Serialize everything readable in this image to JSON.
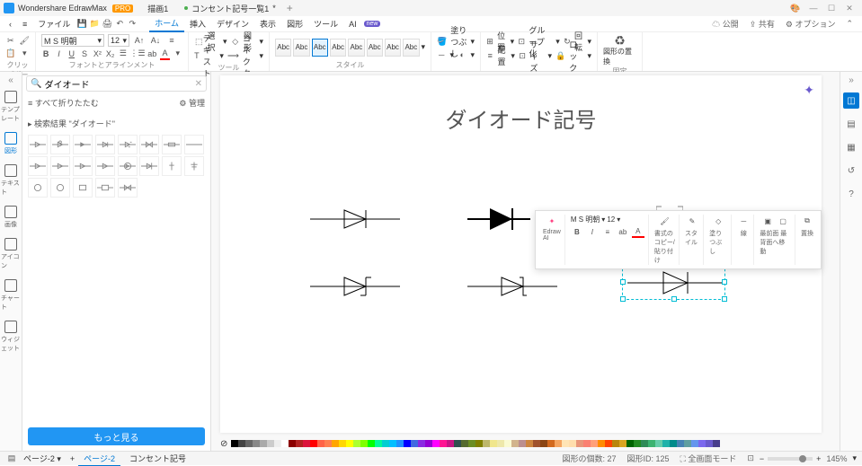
{
  "app": {
    "name": "Wondershare EdrawMax",
    "badge": "PRO"
  },
  "tabs": [
    {
      "label": "描画1"
    },
    {
      "label": "コンセント記号一覧1",
      "modified": true
    }
  ],
  "menu": {
    "back": "‹",
    "hamburger": "≡",
    "file": "ファイル",
    "items": [
      "ホーム",
      "挿入",
      "デザイン",
      "表示",
      "図形",
      "ツール",
      "AI"
    ],
    "active": "ホーム",
    "right": [
      "公開",
      "共有",
      "オプション"
    ]
  },
  "ribbon": {
    "clipboard_label": "クリップボード",
    "font_name": "M S 明朝",
    "font_size": "12",
    "font_label": "フォントとアラインメント",
    "tool_label": "ツール",
    "select": "選択",
    "shape": "図形",
    "text": "テキスト",
    "connector": "コネクタ",
    "style_label": "スタイル",
    "fill": "塗りつぶし",
    "position": "位置",
    "group": "グループ化",
    "rotate": "回転",
    "align": "配置",
    "size": "サイズ",
    "lock": "ロック",
    "replace": "図形の置換",
    "fixed": "固定"
  },
  "sidebar": {
    "items": [
      {
        "label": "テンプレート"
      },
      {
        "label": "図形"
      },
      {
        "label": "テキスト"
      },
      {
        "label": "画像"
      },
      {
        "label": "アイコン"
      },
      {
        "label": "チャート"
      },
      {
        "label": "ウィジェット"
      }
    ],
    "active_index": 1
  },
  "search": {
    "value": "ダイオード"
  },
  "panel": {
    "collapse_all": "すべて折りたたむ",
    "manage": "管理",
    "results_title": "検索結果 \"ダイオード\"",
    "more": "もっと見る"
  },
  "canvas": {
    "title": "ダイオード記号"
  },
  "floating": {
    "ai": "Edraw AI",
    "font": "M S 明朝",
    "size": "12",
    "copy_format": "書式のコピー/貼り付け",
    "style": "スタイル",
    "fill": "塗りつぶし",
    "line": "線",
    "front": "最前面 最背面へ移動",
    "replace": "置換"
  },
  "status": {
    "page1": "ページ-2",
    "page2": "ページ-2",
    "page3": "コンセント記号",
    "shape_count": "図形の個数:  27",
    "shape_id": "図形ID:  125",
    "mode": "全画面モード",
    "zoom": "145%"
  },
  "colors": [
    "#000",
    "#444",
    "#666",
    "#888",
    "#aaa",
    "#ccc",
    "#eee",
    "#fff",
    "#8b0000",
    "#b22222",
    "#dc143c",
    "#ff0000",
    "#ff6347",
    "#ff7f50",
    "#ffa500",
    "#ffd700",
    "#ffff00",
    "#adff2f",
    "#7fff00",
    "#00ff00",
    "#00fa9a",
    "#00ced1",
    "#00bfff",
    "#1e90ff",
    "#0000ff",
    "#4169e1",
    "#8a2be2",
    "#9400d3",
    "#ff00ff",
    "#ff1493",
    "#c71585",
    "#2f4f4f",
    "#556b2f",
    "#6b8e23",
    "#808000",
    "#bdb76b",
    "#f0e68c",
    "#eee8aa",
    "#fafad2",
    "#d2b48c",
    "#bc8f8f",
    "#cd853f",
    "#a0522d",
    "#8b4513",
    "#d2691e",
    "#f4a460",
    "#ffe4b5",
    "#ffdead",
    "#e9967a",
    "#fa8072",
    "#ffa07a",
    "#ff8c00",
    "#ff4500",
    "#b8860b",
    "#daa520",
    "#006400",
    "#228b22",
    "#2e8b57",
    "#3cb371",
    "#66cdaa",
    "#20b2aa",
    "#008b8b",
    "#4682b4",
    "#5f9ea0",
    "#6495ed",
    "#7b68ee",
    "#6a5acd",
    "#483d8b"
  ]
}
